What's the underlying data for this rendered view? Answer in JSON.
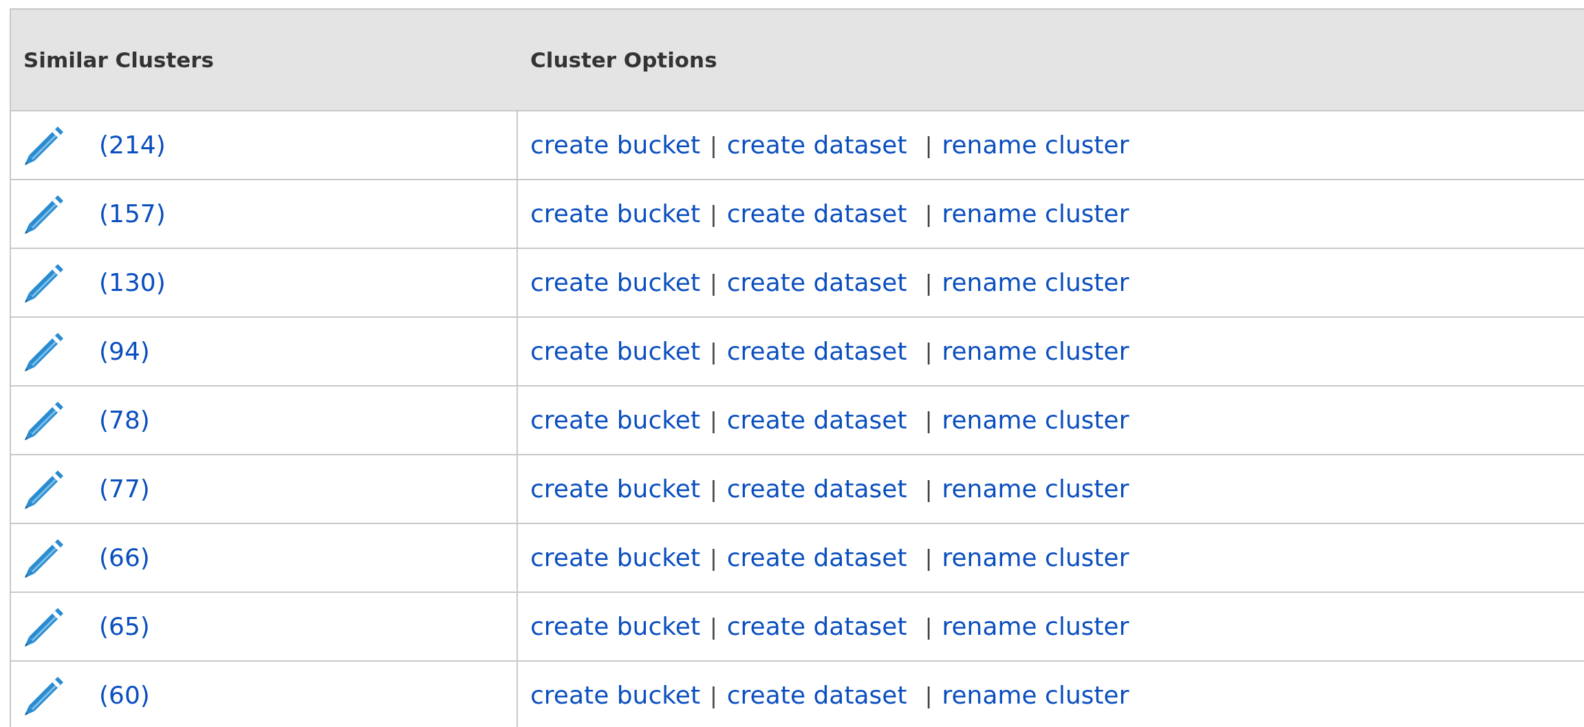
{
  "table": {
    "columns": [
      "Similar Clusters",
      "Cluster Options"
    ],
    "rows": [
      {
        "count": "(214)",
        "options": [
          {
            "kind": "link",
            "text": "create bucket"
          },
          {
            "kind": "separator",
            "text": "|"
          },
          {
            "kind": "link",
            "text": "create dataset"
          },
          {
            "kind": "separator",
            "text": "|"
          },
          {
            "kind": "link",
            "text": "rename cluster"
          }
        ]
      },
      {
        "count": "(157)",
        "options": [
          {
            "kind": "link",
            "text": "create bucket"
          },
          {
            "kind": "separator",
            "text": "|"
          },
          {
            "kind": "link",
            "text": "create dataset"
          },
          {
            "kind": "separator",
            "text": "|"
          },
          {
            "kind": "link",
            "text": "rename cluster"
          }
        ]
      },
      {
        "count": "(130)",
        "options": [
          {
            "kind": "link",
            "text": "create bucket"
          },
          {
            "kind": "separator",
            "text": "|"
          },
          {
            "kind": "link",
            "text": "create dataset"
          },
          {
            "kind": "separator",
            "text": "|"
          },
          {
            "kind": "link",
            "text": "rename cluster"
          }
        ]
      },
      {
        "count": "(94)",
        "options": [
          {
            "kind": "link",
            "text": "create bucket"
          },
          {
            "kind": "separator",
            "text": "|"
          },
          {
            "kind": "link",
            "text": "create dataset"
          },
          {
            "kind": "separator",
            "text": "|"
          },
          {
            "kind": "link",
            "text": "rename cluster"
          }
        ]
      },
      {
        "count": "(78)",
        "options": [
          {
            "kind": "link",
            "text": "create bucket"
          },
          {
            "kind": "separator",
            "text": "|"
          },
          {
            "kind": "link",
            "text": "create dataset"
          },
          {
            "kind": "separator",
            "text": "|"
          },
          {
            "kind": "link",
            "text": "rename cluster"
          }
        ]
      },
      {
        "count": "(77)",
        "options": [
          {
            "kind": "link",
            "text": "create bucket"
          },
          {
            "kind": "separator",
            "text": "|"
          },
          {
            "kind": "link",
            "text": "create dataset"
          },
          {
            "kind": "separator",
            "text": "|"
          },
          {
            "kind": "link",
            "text": "rename cluster"
          }
        ]
      },
      {
        "count": "(66)",
        "options": [
          {
            "kind": "link",
            "text": "create bucket"
          },
          {
            "kind": "separator",
            "text": "|"
          },
          {
            "kind": "link",
            "text": "create dataset"
          },
          {
            "kind": "separator",
            "text": "|"
          },
          {
            "kind": "link",
            "text": "rename cluster"
          }
        ]
      },
      {
        "count": "(65)",
        "options": [
          {
            "kind": "link",
            "text": "create bucket"
          },
          {
            "kind": "separator",
            "text": "|"
          },
          {
            "kind": "link",
            "text": "create dataset"
          },
          {
            "kind": "separator",
            "text": "|"
          },
          {
            "kind": "link",
            "text": "rename cluster"
          }
        ]
      },
      {
        "count": "(60)",
        "options": [
          {
            "kind": "link",
            "text": "create bucket"
          },
          {
            "kind": "separator",
            "text": "|"
          },
          {
            "kind": "link",
            "text": "create dataset"
          },
          {
            "kind": "separator",
            "text": "|"
          },
          {
            "kind": "link",
            "text": "rename cluster"
          }
        ]
      }
    ]
  }
}
